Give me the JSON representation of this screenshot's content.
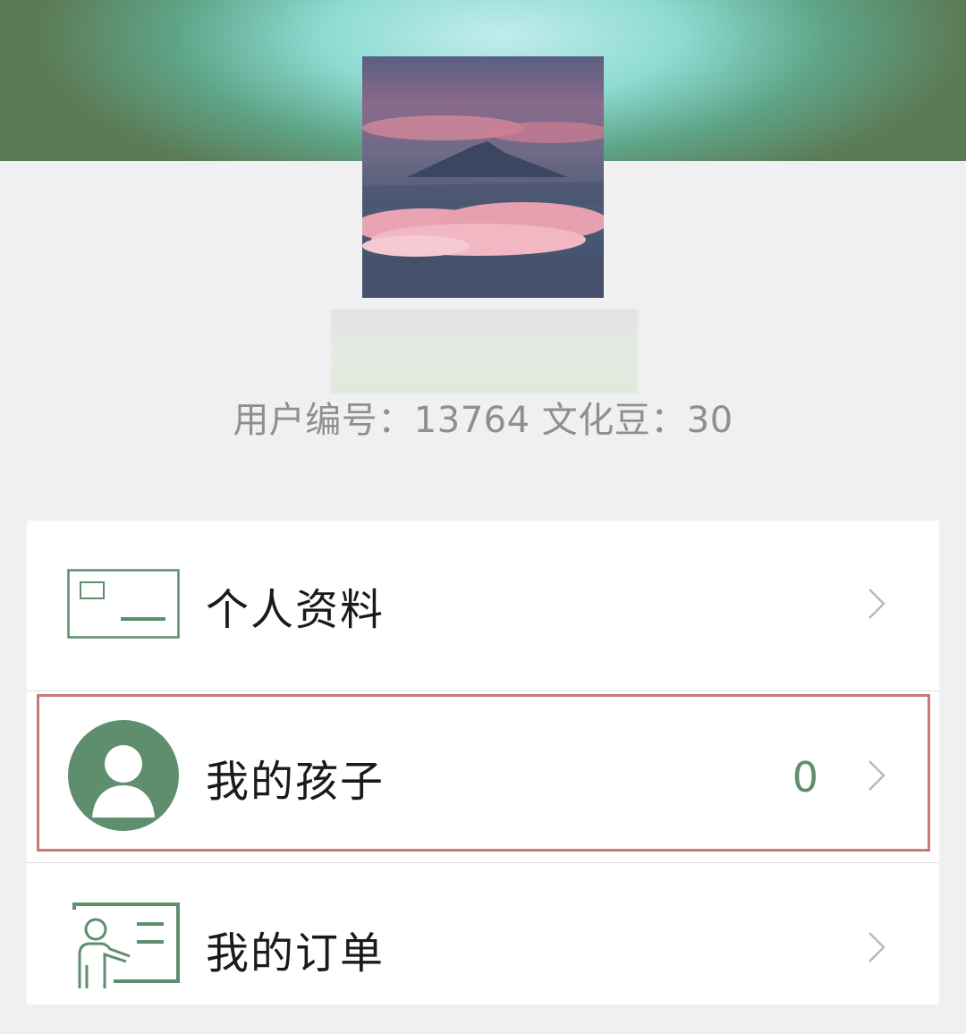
{
  "profile": {
    "user_meta_text": "用户编号：13764 文化豆：30"
  },
  "menu": {
    "items": [
      {
        "label": "个人资料",
        "icon": "id-card-icon"
      },
      {
        "label": "我的孩子",
        "icon": "child-avatar-icon",
        "count": "0"
      },
      {
        "label": "我的订单",
        "icon": "teacher-board-icon"
      }
    ]
  },
  "colors": {
    "accent_green": "#5e8e6d",
    "highlight_border": "#c77a7a",
    "page_background": "#f0f0f3"
  }
}
